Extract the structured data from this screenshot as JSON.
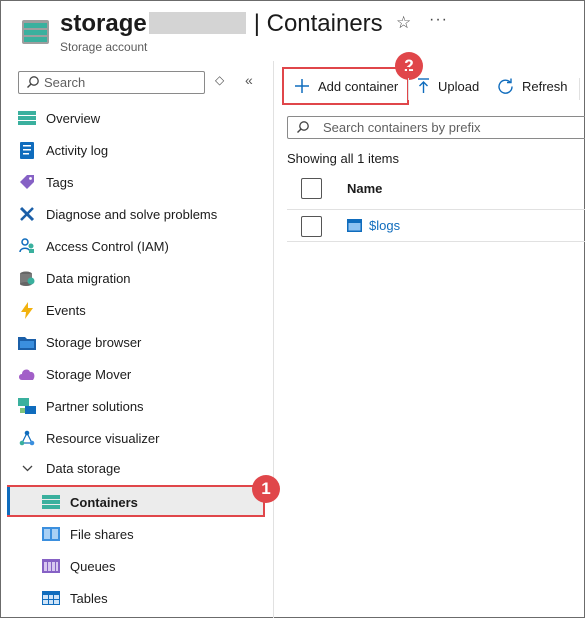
{
  "header": {
    "resource_name": "storage",
    "page_title": "| Containers",
    "resource_type": "Storage account",
    "favorite_icon": "star-icon",
    "more_icon": "ellipsis-icon"
  },
  "sidebar": {
    "search_placeholder": "Search",
    "items": [
      {
        "label": "Overview",
        "icon": "overview-icon"
      },
      {
        "label": "Activity log",
        "icon": "activity-log-icon"
      },
      {
        "label": "Tags",
        "icon": "tag-icon"
      },
      {
        "label": "Diagnose and solve problems",
        "icon": "wrench-icon"
      },
      {
        "label": "Access Control (IAM)",
        "icon": "people-icon"
      },
      {
        "label": "Data migration",
        "icon": "data-migration-icon"
      },
      {
        "label": "Events",
        "icon": "lightning-icon"
      },
      {
        "label": "Storage browser",
        "icon": "folder-icon"
      },
      {
        "label": "Storage Mover",
        "icon": "cloud-icon"
      },
      {
        "label": "Partner solutions",
        "icon": "partner-icon"
      },
      {
        "label": "Resource visualizer",
        "icon": "graph-icon"
      }
    ],
    "group": {
      "label": "Data storage",
      "expanded": true
    },
    "sub_items": [
      {
        "label": "Containers",
        "icon": "containers-icon",
        "selected": true
      },
      {
        "label": "File shares",
        "icon": "file-shares-icon"
      },
      {
        "label": "Queues",
        "icon": "queues-icon"
      },
      {
        "label": "Tables",
        "icon": "tables-icon"
      }
    ]
  },
  "toolbar": {
    "add_label": "Add container",
    "upload_label": "Upload",
    "refresh_label": "Refresh"
  },
  "main": {
    "search_placeholder": "Search containers by prefix",
    "showing_text": "Showing all 1 items",
    "column_header": "Name",
    "rows": [
      {
        "name": "$logs"
      }
    ]
  },
  "callouts": {
    "step1": "1",
    "step2": "2"
  },
  "colors": {
    "accent": "#0f6cbd",
    "highlight": "#e0464a",
    "storage_teal": "#3ab09e"
  }
}
